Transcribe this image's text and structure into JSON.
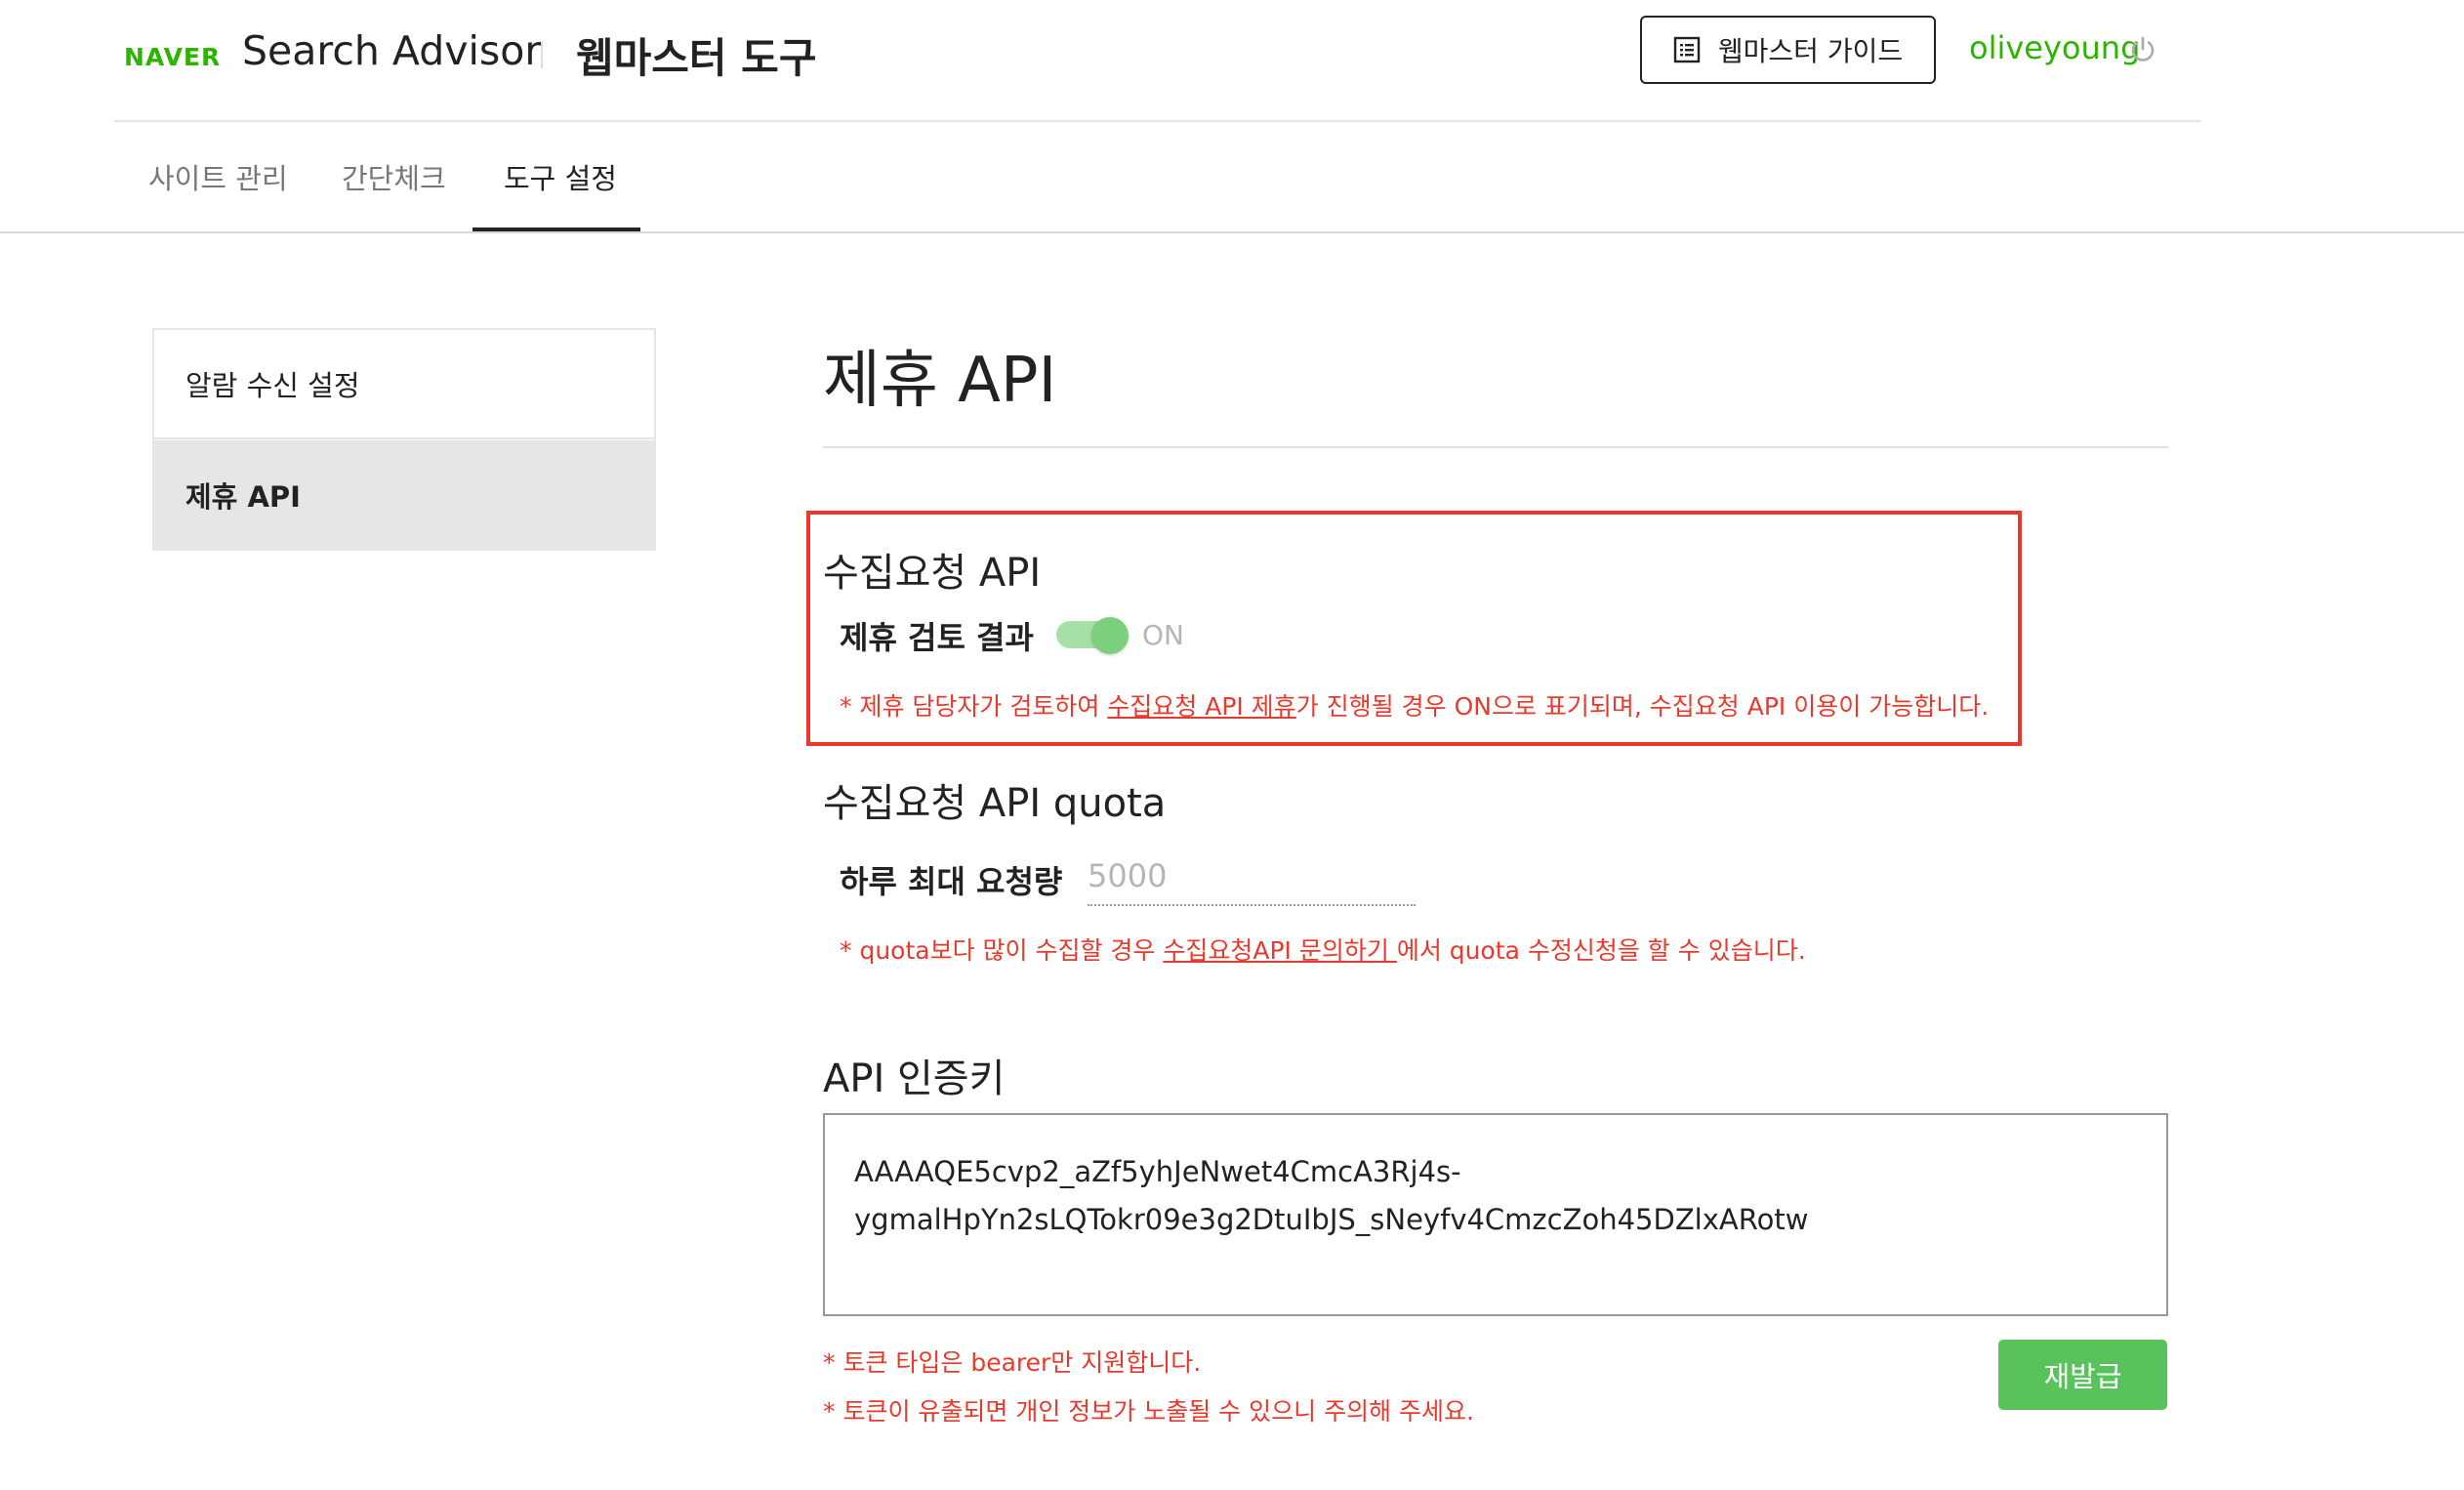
{
  "header": {
    "brand": "NAVER",
    "product": "Search Advisor",
    "section": "웹마스터 도구",
    "guide_button": "웹마스터 가이드",
    "username": "oliveyoung"
  },
  "tabs": [
    {
      "label": "사이트 관리"
    },
    {
      "label": "간단체크"
    },
    {
      "label": "도구 설정"
    }
  ],
  "active_tab": "도구 설정",
  "sidebar": {
    "items": [
      {
        "label": "알람 수신 설정"
      },
      {
        "label": "제휴 API"
      }
    ],
    "active_item": "제휴 API"
  },
  "main": {
    "title": "제휴 API",
    "collect_api": {
      "heading": "수집요청 API",
      "field_label": "제휴 검토 결과",
      "toggle_state": "ON",
      "note_prefix": "* 제휴 담당자가 검토하여 ",
      "note_link": "수집요청 API 제휴",
      "note_suffix": "가 진행될 경우 ON으로 표기되며, 수집요청 API 이용이 가능합니다."
    },
    "quota": {
      "heading": "수집요청 API quota",
      "field_label": "하루 최대 요청량",
      "value": "5000",
      "note_prefix": "* quota보다 많이 수집할 경우 ",
      "note_link": "수집요청API 문의하기 ",
      "note_suffix": "에서 quota 수정신청을 할 수 있습니다."
    },
    "api_key": {
      "heading": "API 인증키",
      "key_line1": "AAAAQE5cvp2_aZf5yhJeNwet4CmcA3Rj4s-",
      "key_line2": "ygmalHpYn2sLQTokr09e3g2DtuIbJS_sNeyfv4CmzcZoh45DZlxARotw",
      "note1": "* 토큰 타입은 bearer만 지원합니다.",
      "note2": "* 토큰이 유출되면 개인 정보가 노출될 수 있으니 주의해 주세요.",
      "reissue_button": "재발급"
    }
  },
  "colors": {
    "brand_green": "#2db400",
    "button_green": "#5ac25a",
    "alert_red": "#e8392c"
  }
}
